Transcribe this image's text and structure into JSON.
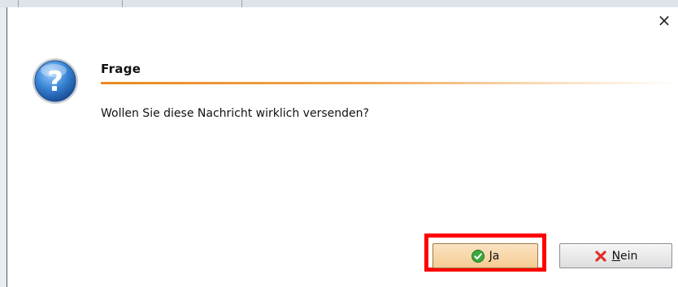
{
  "dialog": {
    "title": "Frage",
    "message": "Wollen Sie diese Nachricht wirklich versenden?",
    "close_glyph": "×"
  },
  "buttons": {
    "yes": {
      "mnemonic": "J",
      "rest": "a",
      "icon": "check-circle-icon"
    },
    "no": {
      "mnemonic": "N",
      "rest": "ein",
      "icon": "red-x-icon"
    }
  },
  "colors": {
    "accent_divider": "#e88a1e",
    "highlight_box": "#ff0000",
    "question_icon": "#2a6fc0"
  }
}
